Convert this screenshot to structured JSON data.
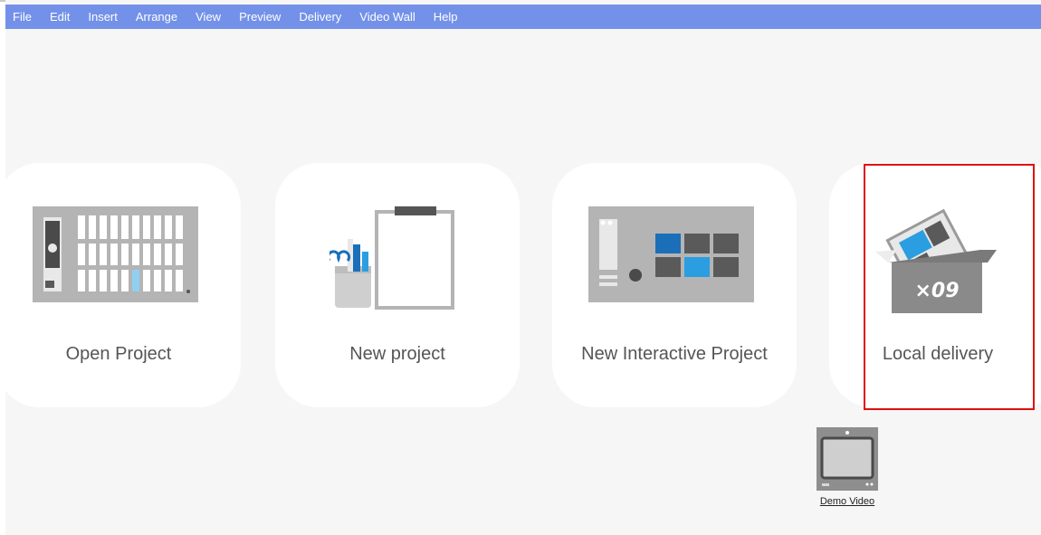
{
  "menu": [
    "File",
    "Edit",
    "Insert",
    "Arrange",
    "View",
    "Preview",
    "Delivery",
    "Video Wall",
    "Help"
  ],
  "cards": {
    "open_project": "Open Project",
    "new_project": "New project",
    "new_interactive_project": "New Interactive Project",
    "local_delivery": "Local delivery",
    "box_text": "×09"
  },
  "demo": {
    "label": "Demo Video"
  },
  "colors": {
    "menubar": "#7391e8",
    "card_bg": "#ffffff",
    "page_bg": "#f6f6f6",
    "accent_blue": "#2a9ee0",
    "dark_blue": "#1a6fb8",
    "highlight": "#e01010"
  },
  "icons": [
    "open-project-icon",
    "new-project-icon",
    "interactive-project-icon",
    "local-delivery-icon",
    "demo-video-icon"
  ]
}
